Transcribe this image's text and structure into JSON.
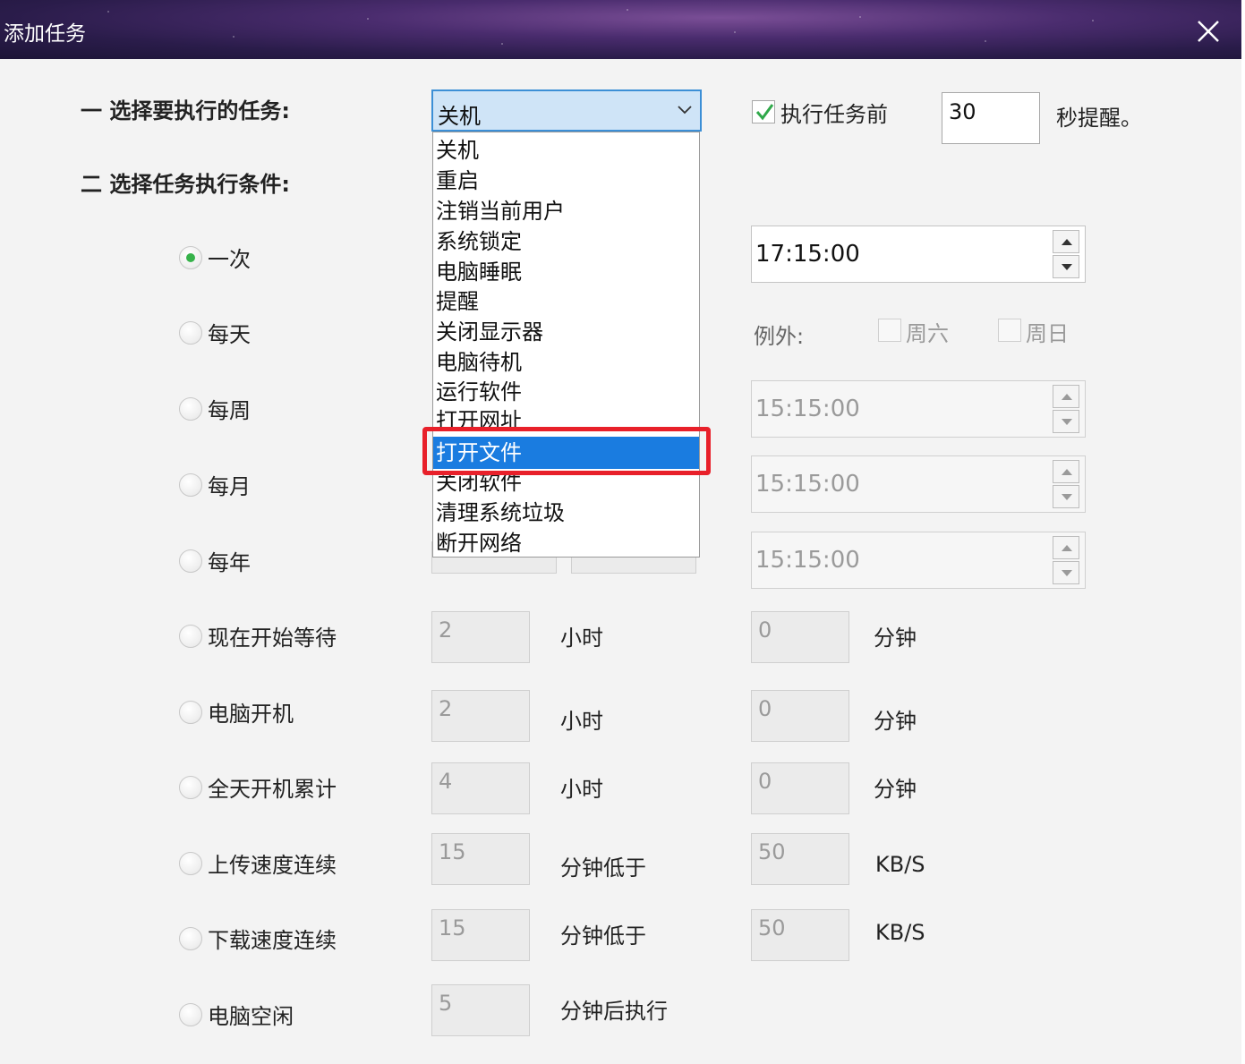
{
  "window": {
    "title": "添加任务"
  },
  "sections": {
    "task": "一 选择要执行的任务:",
    "condition": "二 选择任务执行条件:"
  },
  "task_select": {
    "value": "关机",
    "options": [
      "关机",
      "重启",
      "注销当前用户",
      "系统锁定",
      "电脑睡眠",
      "提醒",
      "关闭显示器",
      "电脑待机",
      "运行软件",
      "打开网址",
      "打开文件",
      "关闭软件",
      "清理系统垃圾",
      "断开网络"
    ],
    "highlighted": "打开文件"
  },
  "reminder": {
    "checked": true,
    "label": "执行任务前",
    "seconds": "30",
    "suffix": "秒提醒。"
  },
  "exceptions": {
    "label": "例外:",
    "saturday": "周六",
    "sunday": "周日"
  },
  "radios": [
    {
      "label": "一次",
      "selected": true
    },
    {
      "label": "每天",
      "selected": false
    },
    {
      "label": "每周",
      "selected": false
    },
    {
      "label": "每月",
      "selected": false
    },
    {
      "label": "每年",
      "selected": false
    },
    {
      "label": "现在开始等待",
      "selected": false
    },
    {
      "label": "电脑开机",
      "selected": false
    },
    {
      "label": "全天开机累计",
      "selected": false
    },
    {
      "label": "上传速度连续",
      "selected": false
    },
    {
      "label": "下载速度连续",
      "selected": false
    },
    {
      "label": "电脑空闲",
      "selected": false
    }
  ],
  "times": {
    "once": "17:15:00",
    "weekly": "15:15:00",
    "monthly": "15:15:00",
    "yearly": "15:15:00"
  },
  "wait_now": {
    "hours": "2",
    "hours_unit": "小时",
    "minutes": "0",
    "minutes_unit": "分钟"
  },
  "boot": {
    "hours": "2",
    "hours_unit": "小时",
    "minutes": "0",
    "minutes_unit": "分钟"
  },
  "uptime": {
    "hours": "4",
    "hours_unit": "小时",
    "minutes": "0",
    "minutes_unit": "分钟"
  },
  "upload": {
    "minutes": "15",
    "unit": "分钟低于",
    "speed": "50",
    "speed_unit": "KB/S"
  },
  "download": {
    "minutes": "15",
    "unit": "分钟低于",
    "speed": "50",
    "speed_unit": "KB/S"
  },
  "idle": {
    "minutes": "5",
    "unit": "分钟后执行"
  },
  "colors": {
    "accent": "#1a7ce0",
    "radio_on": "#36b24a",
    "highlight_border": "#e8202a"
  }
}
